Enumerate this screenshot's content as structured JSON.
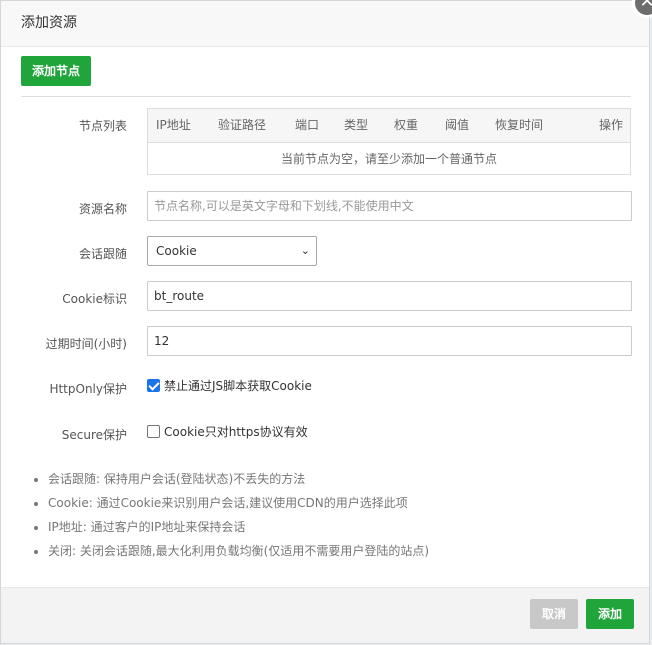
{
  "dialog": {
    "title": "添加资源"
  },
  "toolbar": {
    "add_node_label": "添加节点"
  },
  "nodes": {
    "label": "节点列表",
    "columns": [
      "IP地址",
      "验证路径",
      "端口",
      "类型",
      "权重",
      "阈值",
      "恢复时间",
      "操作"
    ],
    "empty_text": "当前节点为空，请至少添加一个普通节点"
  },
  "resource_name": {
    "label": "资源名称",
    "placeholder": "节点名称,可以是英文字母和下划线,不能使用中文",
    "value": ""
  },
  "session": {
    "label": "会话跟随",
    "selected": "Cookie"
  },
  "cookie_id": {
    "label": "Cookie标识",
    "value": "bt_route"
  },
  "expire": {
    "label": "过期时间(小时)",
    "value": "12"
  },
  "httponly": {
    "label": "HttpOnly保护",
    "checked": true,
    "text": "禁止通过JS脚本获取Cookie"
  },
  "secure": {
    "label": "Secure保护",
    "checked": false,
    "text": "Cookie只对https协议有效"
  },
  "notes": [
    "会话跟随: 保持用户会话(登陆状态)不丢失的方法",
    "Cookie: 通过Cookie来识别用户会话,建议使用CDN的用户选择此项",
    "IP地址: 通过客户的IP地址来保持会话",
    "关闭: 关闭会话跟随,最大化利用负载均衡(仅适用不需要用户登陆的站点)"
  ],
  "footer": {
    "cancel_label": "取消",
    "add_label": "添加"
  },
  "icons": {
    "close": "close-icon",
    "select": "chevron-down-icon"
  },
  "colors": {
    "primary": "#20a53a",
    "disabled": "#c8c8c8",
    "checkbox": "#1a73e8"
  }
}
